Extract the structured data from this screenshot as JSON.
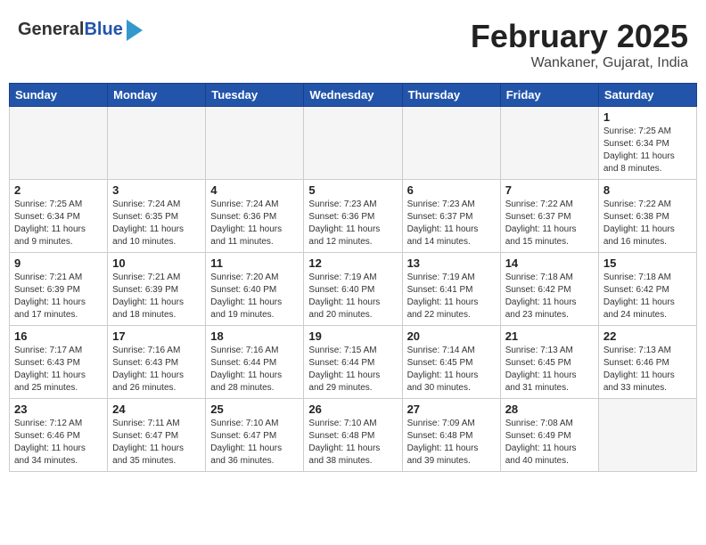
{
  "header": {
    "logo_general": "General",
    "logo_blue": "Blue",
    "month_title": "February 2025",
    "location": "Wankaner, Gujarat, India"
  },
  "weekdays": [
    "Sunday",
    "Monday",
    "Tuesday",
    "Wednesday",
    "Thursday",
    "Friday",
    "Saturday"
  ],
  "weeks": [
    [
      {
        "day": "",
        "info": ""
      },
      {
        "day": "",
        "info": ""
      },
      {
        "day": "",
        "info": ""
      },
      {
        "day": "",
        "info": ""
      },
      {
        "day": "",
        "info": ""
      },
      {
        "day": "",
        "info": ""
      },
      {
        "day": "1",
        "info": "Sunrise: 7:25 AM\nSunset: 6:34 PM\nDaylight: 11 hours and 8 minutes."
      }
    ],
    [
      {
        "day": "2",
        "info": "Sunrise: 7:25 AM\nSunset: 6:34 PM\nDaylight: 11 hours and 9 minutes."
      },
      {
        "day": "3",
        "info": "Sunrise: 7:24 AM\nSunset: 6:35 PM\nDaylight: 11 hours and 10 minutes."
      },
      {
        "day": "4",
        "info": "Sunrise: 7:24 AM\nSunset: 6:36 PM\nDaylight: 11 hours and 11 minutes."
      },
      {
        "day": "5",
        "info": "Sunrise: 7:23 AM\nSunset: 6:36 PM\nDaylight: 11 hours and 12 minutes."
      },
      {
        "day": "6",
        "info": "Sunrise: 7:23 AM\nSunset: 6:37 PM\nDaylight: 11 hours and 14 minutes."
      },
      {
        "day": "7",
        "info": "Sunrise: 7:22 AM\nSunset: 6:37 PM\nDaylight: 11 hours and 15 minutes."
      },
      {
        "day": "8",
        "info": "Sunrise: 7:22 AM\nSunset: 6:38 PM\nDaylight: 11 hours and 16 minutes."
      }
    ],
    [
      {
        "day": "9",
        "info": "Sunrise: 7:21 AM\nSunset: 6:39 PM\nDaylight: 11 hours and 17 minutes."
      },
      {
        "day": "10",
        "info": "Sunrise: 7:21 AM\nSunset: 6:39 PM\nDaylight: 11 hours and 18 minutes."
      },
      {
        "day": "11",
        "info": "Sunrise: 7:20 AM\nSunset: 6:40 PM\nDaylight: 11 hours and 19 minutes."
      },
      {
        "day": "12",
        "info": "Sunrise: 7:19 AM\nSunset: 6:40 PM\nDaylight: 11 hours and 20 minutes."
      },
      {
        "day": "13",
        "info": "Sunrise: 7:19 AM\nSunset: 6:41 PM\nDaylight: 11 hours and 22 minutes."
      },
      {
        "day": "14",
        "info": "Sunrise: 7:18 AM\nSunset: 6:42 PM\nDaylight: 11 hours and 23 minutes."
      },
      {
        "day": "15",
        "info": "Sunrise: 7:18 AM\nSunset: 6:42 PM\nDaylight: 11 hours and 24 minutes."
      }
    ],
    [
      {
        "day": "16",
        "info": "Sunrise: 7:17 AM\nSunset: 6:43 PM\nDaylight: 11 hours and 25 minutes."
      },
      {
        "day": "17",
        "info": "Sunrise: 7:16 AM\nSunset: 6:43 PM\nDaylight: 11 hours and 26 minutes."
      },
      {
        "day": "18",
        "info": "Sunrise: 7:16 AM\nSunset: 6:44 PM\nDaylight: 11 hours and 28 minutes."
      },
      {
        "day": "19",
        "info": "Sunrise: 7:15 AM\nSunset: 6:44 PM\nDaylight: 11 hours and 29 minutes."
      },
      {
        "day": "20",
        "info": "Sunrise: 7:14 AM\nSunset: 6:45 PM\nDaylight: 11 hours and 30 minutes."
      },
      {
        "day": "21",
        "info": "Sunrise: 7:13 AM\nSunset: 6:45 PM\nDaylight: 11 hours and 31 minutes."
      },
      {
        "day": "22",
        "info": "Sunrise: 7:13 AM\nSunset: 6:46 PM\nDaylight: 11 hours and 33 minutes."
      }
    ],
    [
      {
        "day": "23",
        "info": "Sunrise: 7:12 AM\nSunset: 6:46 PM\nDaylight: 11 hours and 34 minutes."
      },
      {
        "day": "24",
        "info": "Sunrise: 7:11 AM\nSunset: 6:47 PM\nDaylight: 11 hours and 35 minutes."
      },
      {
        "day": "25",
        "info": "Sunrise: 7:10 AM\nSunset: 6:47 PM\nDaylight: 11 hours and 36 minutes."
      },
      {
        "day": "26",
        "info": "Sunrise: 7:10 AM\nSunset: 6:48 PM\nDaylight: 11 hours and 38 minutes."
      },
      {
        "day": "27",
        "info": "Sunrise: 7:09 AM\nSunset: 6:48 PM\nDaylight: 11 hours and 39 minutes."
      },
      {
        "day": "28",
        "info": "Sunrise: 7:08 AM\nSunset: 6:49 PM\nDaylight: 11 hours and 40 minutes."
      },
      {
        "day": "",
        "info": ""
      }
    ]
  ]
}
